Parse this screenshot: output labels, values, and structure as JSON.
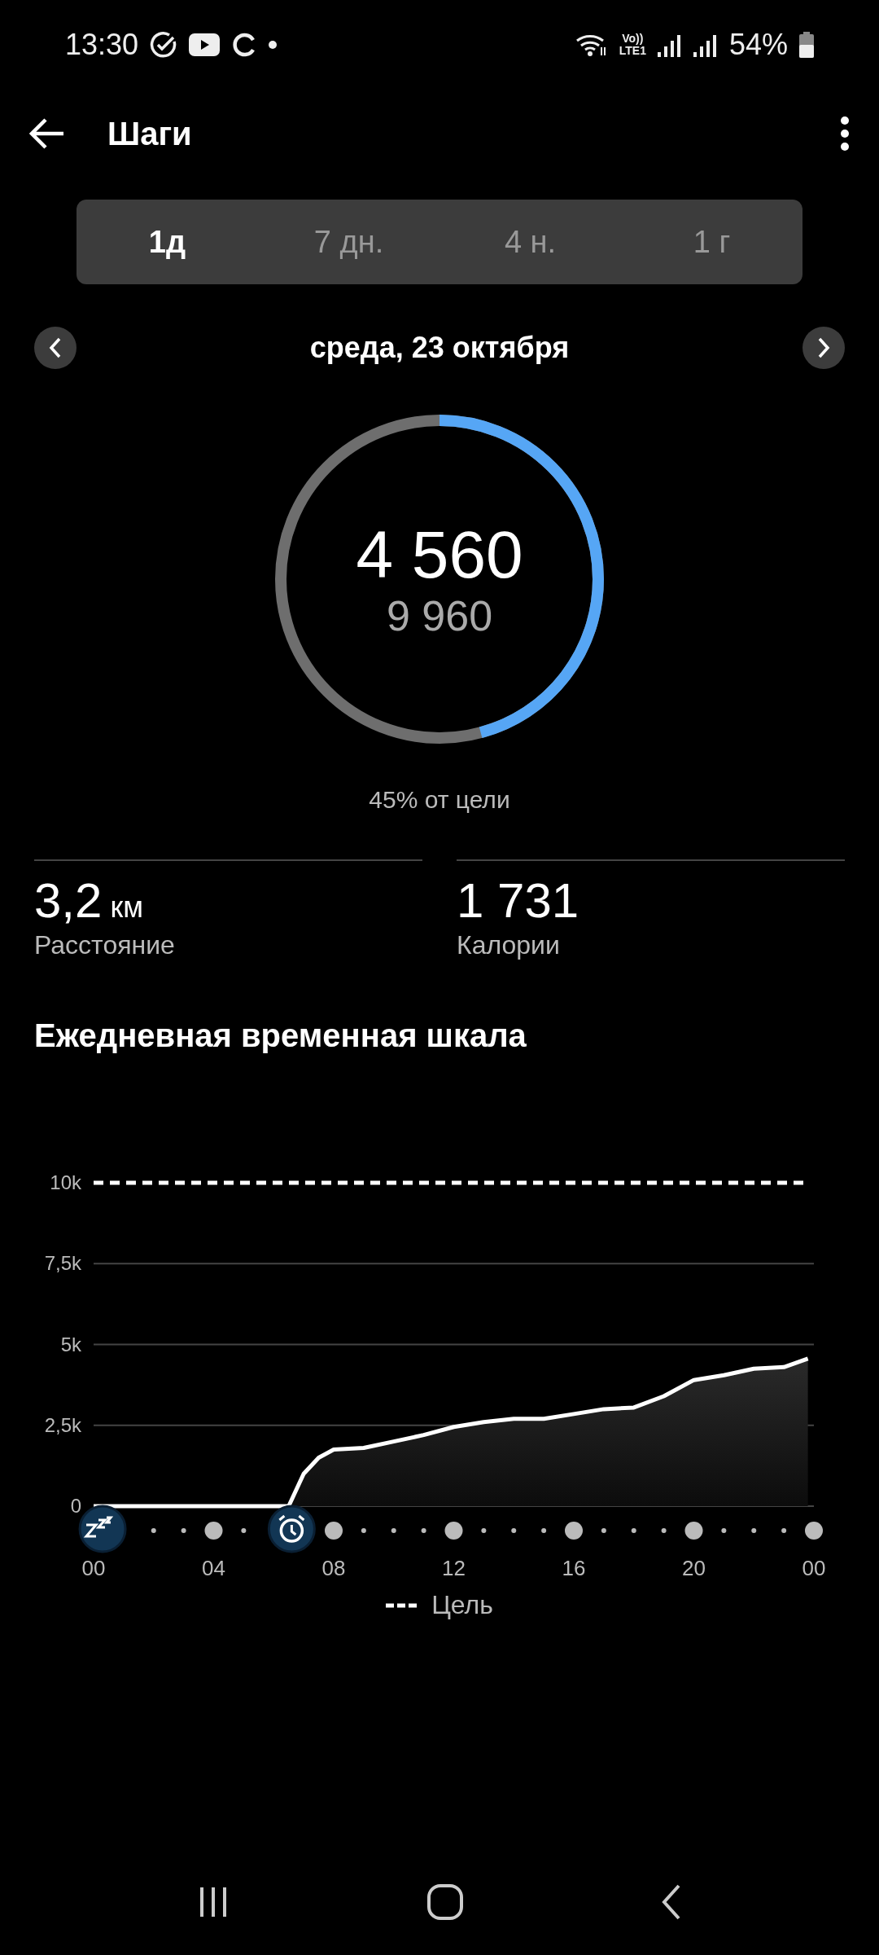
{
  "status_bar": {
    "time": "13:30",
    "network": "Vo))\nLTE1",
    "battery": "54%"
  },
  "header": {
    "title": "Шаги"
  },
  "tabs": [
    {
      "label": "1д",
      "selected": true
    },
    {
      "label": "7 дн.",
      "selected": false
    },
    {
      "label": "4 н.",
      "selected": false
    },
    {
      "label": "1 г",
      "selected": false
    }
  ],
  "date": "среда, 23 октября",
  "ring": {
    "steps": "4 560",
    "goal": "9 960",
    "level": 0.458,
    "caption": "45% от цели"
  },
  "stats": [
    {
      "value": "3,2",
      "unit": "км",
      "label": "Расстояние"
    },
    {
      "value": "1 731",
      "label": "Калории"
    }
  ],
  "timeline": {
    "title": "Ежедневная временная шкала",
    "chart_data": {
      "type": "area",
      "x": [
        0,
        6.5,
        7,
        7.5,
        8,
        9,
        10,
        11,
        12,
        13,
        14,
        15,
        16,
        17,
        18,
        19,
        20,
        21,
        22,
        23,
        23.8
      ],
      "series": [
        {
          "color": "#ffffff",
          "values": [
            0,
            0,
            1000,
            1500,
            1750,
            1800,
            2000,
            2200,
            2450,
            2600,
            2700,
            2700,
            2850,
            3000,
            3050,
            3400,
            3900,
            4050,
            4250,
            4300,
            4560
          ]
        },
        {
          "name": "Цель",
          "type": "line",
          "line_style": "dashed",
          "color": "#ffffff",
          "values": [
            10000,
            10000,
            10000,
            10000,
            10000,
            10000,
            10000,
            10000,
            10000,
            10000,
            10000,
            10000,
            10000,
            10000,
            10000,
            10000,
            10000,
            10000,
            10000,
            10000,
            10000
          ]
        }
      ],
      "grid": true,
      "xlim": [
        0,
        24
      ],
      "ylim": [
        0,
        10000
      ],
      "xticks": [
        {
          "value": 0,
          "label": "00"
        },
        {
          "value": 4,
          "label": "04"
        },
        {
          "value": 8,
          "label": "08"
        },
        {
          "value": 12,
          "label": "12"
        },
        {
          "value": 16,
          "label": "16"
        },
        {
          "value": 20,
          "label": "20"
        },
        {
          "value": 24,
          "label": "00"
        }
      ],
      "yticks": [
        {
          "value": 0,
          "label": "0"
        },
        {
          "value": 2500,
          "label": "2,5k"
        },
        {
          "value": 5000,
          "label": "5k"
        },
        {
          "value": 7500,
          "label": "7,5k"
        },
        {
          "value": 10000,
          "label": "10k"
        }
      ]
    }
  }
}
